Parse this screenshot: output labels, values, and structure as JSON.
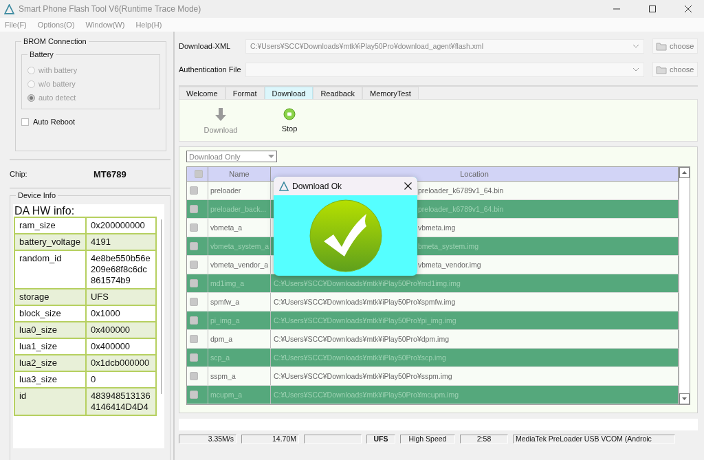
{
  "window": {
    "title": "Smart Phone Flash Tool V6(Runtime Trace Mode)"
  },
  "menu": [
    "File(F)",
    "Options(O)",
    "Window(W)",
    "Help(H)"
  ],
  "brom": {
    "title": "BROM Connection",
    "battery_title": "Battery",
    "battery_options": [
      {
        "label": "with battery",
        "selected": false,
        "disabled": true
      },
      {
        "label": "w/o battery",
        "selected": false,
        "disabled": true
      },
      {
        "label": "auto detect",
        "selected": true,
        "disabled": true
      }
    ],
    "auto_reboot": {
      "label": "Auto Reboot",
      "checked": false
    }
  },
  "chip": {
    "label": "Chip:",
    "value": "MT6789"
  },
  "device_info": {
    "title": "Device Info",
    "heading": "DA HW info:",
    "rows": [
      {
        "key": "ram_size",
        "value": "0x200000000"
      },
      {
        "key": "battery_voltage",
        "value": "4191"
      },
      {
        "key": "random_id",
        "value": "4e8be550b56e209e68f8c6dc861574b9"
      },
      {
        "key": "storage",
        "value": "UFS"
      },
      {
        "key": "block_size",
        "value": "0x1000"
      },
      {
        "key": "lua0_size",
        "value": "0x400000"
      },
      {
        "key": "lua1_size",
        "value": "0x400000"
      },
      {
        "key": "lua2_size",
        "value": "0x1dcb000000"
      },
      {
        "key": "lua3_size",
        "value": "0"
      },
      {
        "key": "id",
        "value": "4839485131364146414D4D4"
      }
    ]
  },
  "download_xml": {
    "label": "Download-XML",
    "value": "C:¥Users¥SCC¥Downloads¥mtk¥iPlay50Pro¥download_agent¥flash.xml",
    "button": "choose"
  },
  "auth_file": {
    "label": "Authentication File",
    "button": "choose"
  },
  "tabs": [
    {
      "label": "Welcome",
      "selected": false
    },
    {
      "label": "Format",
      "selected": false
    },
    {
      "label": "Download",
      "selected": true
    },
    {
      "label": "Readback",
      "selected": false
    },
    {
      "label": "MemoryTest",
      "selected": false
    }
  ],
  "toolbar": [
    {
      "kind": "download",
      "label": "Download",
      "disabled": true
    },
    {
      "kind": "stop",
      "label": "Stop",
      "disabled": false
    }
  ],
  "mode_select": "Download Only",
  "table": {
    "columns": [
      "Name",
      "Location"
    ],
    "header_checked": true,
    "rows": [
      {
        "checked": true,
        "name": "preloader",
        "location": "preloader_k6789v1_64.bin"
      },
      {
        "checked": true,
        "name": "preloader_back...",
        "location": "preloader_k6789v1_64.bin"
      },
      {
        "checked": true,
        "name": "vbmeta_a",
        "location": "vbmeta.img"
      },
      {
        "checked": true,
        "name": "vbmeta_system_a",
        "location": "bmeta_system.img"
      },
      {
        "checked": true,
        "name": "vbmeta_vendor_a",
        "location": "vbmeta_vendor.img"
      },
      {
        "checked": true,
        "name": "md1img_a",
        "location": "C:¥Users¥SCC¥Downloads¥mtk¥iPlay50Pro¥md1img.img"
      },
      {
        "checked": true,
        "name": "spmfw_a",
        "location": "C:¥Users¥SCC¥Downloads¥mtk¥iPlay50Pro¥spmfw.img"
      },
      {
        "checked": true,
        "name": "pi_img_a",
        "location": "C:¥Users¥SCC¥Downloads¥mtk¥iPlay50Pro¥pi_img.img"
      },
      {
        "checked": true,
        "name": "dpm_a",
        "location": "C:¥Users¥SCC¥Downloads¥mtk¥iPlay50Pro¥dpm.img"
      },
      {
        "checked": true,
        "name": "scp_a",
        "location": "C:¥Users¥SCC¥Downloads¥mtk¥iPlay50Pro¥scp.img"
      },
      {
        "checked": true,
        "name": "sspm_a",
        "location": "C:¥Users¥SCC¥Downloads¥mtk¥iPlay50Pro¥sspm.img"
      },
      {
        "checked": true,
        "name": "mcupm_a",
        "location": "C:¥Users¥SCC¥Downloads¥mtk¥iPlay50Pro¥mcupm.img"
      }
    ]
  },
  "dialog": {
    "title": "Download Ok"
  },
  "progress": {
    "level": 0
  },
  "status_bar": [
    {
      "kind": "text",
      "text": "3.35M/s",
      "bold": false
    },
    {
      "kind": "text",
      "text": "14.70M",
      "bold": false
    },
    {
      "kind": "blank"
    },
    {
      "kind": "text",
      "text": "UFS",
      "bold": true
    },
    {
      "kind": "text",
      "text": "High Speed",
      "bold": false
    },
    {
      "kind": "text",
      "text": "2:58",
      "bold": false
    },
    {
      "kind": "text",
      "text": "MediaTek PreLoader USB VCOM (Androic",
      "bold": false
    }
  ]
}
